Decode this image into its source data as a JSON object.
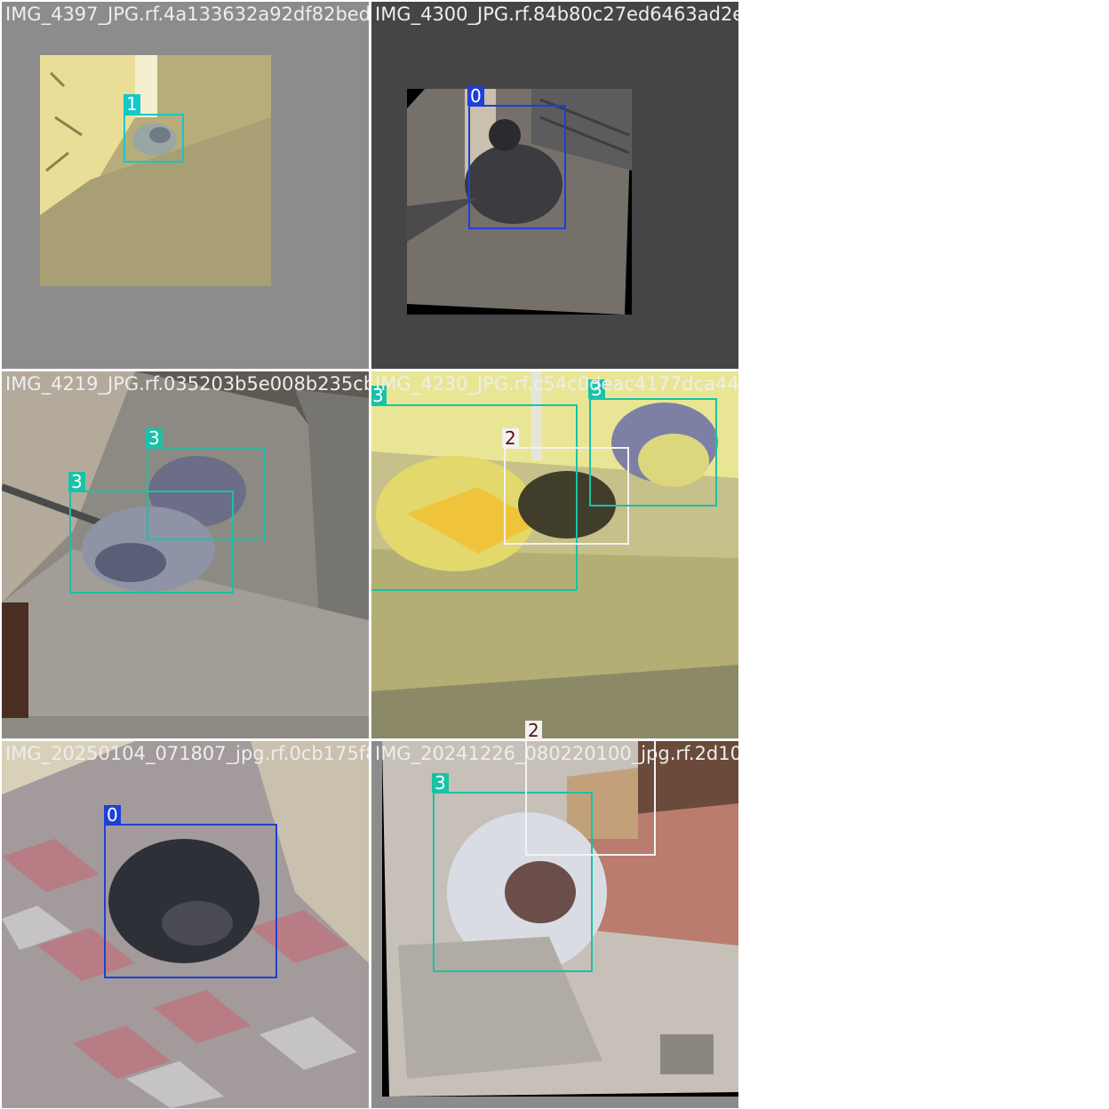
{
  "colors": {
    "class_0": "#1f3fd8",
    "class_1": "#12c8c8",
    "class_2": "#f2f2f2",
    "class_3": "#19c2a6",
    "pad_gray_light": "#8c8c8c",
    "pad_gray_dark": "#454545"
  },
  "tiles": [
    {
      "filename": "IMG_4397_JPG.rf.4a133632a92df82bed7c64130",
      "detections": [
        {
          "class_id": "1"
        }
      ]
    },
    {
      "filename": "IMG_4300_JPG.rf.84b80c27ed6463ad2eb4047a",
      "detections": [
        {
          "class_id": "0"
        }
      ]
    },
    {
      "filename": "IMG_4219_JPG.rf.035203b5e008b235cb4b5230",
      "detections": [
        {
          "class_id": "3"
        },
        {
          "class_id": "3"
        }
      ]
    },
    {
      "filename": "IMG_4230_JPG.rf.c54c0deac4177dca44865156",
      "detections": [
        {
          "class_id": "3"
        },
        {
          "class_id": "2"
        },
        {
          "class_id": "3"
        }
      ]
    },
    {
      "filename": "IMG_20250104_071807_jpg.rf.0cb175f83360",
      "detections": [
        {
          "class_id": "0"
        }
      ]
    },
    {
      "filename": "IMG_20241226_080220100_jpg.rf.2d1014c351",
      "detections": [
        {
          "class_id": "3"
        },
        {
          "class_id": "2"
        }
      ]
    }
  ]
}
